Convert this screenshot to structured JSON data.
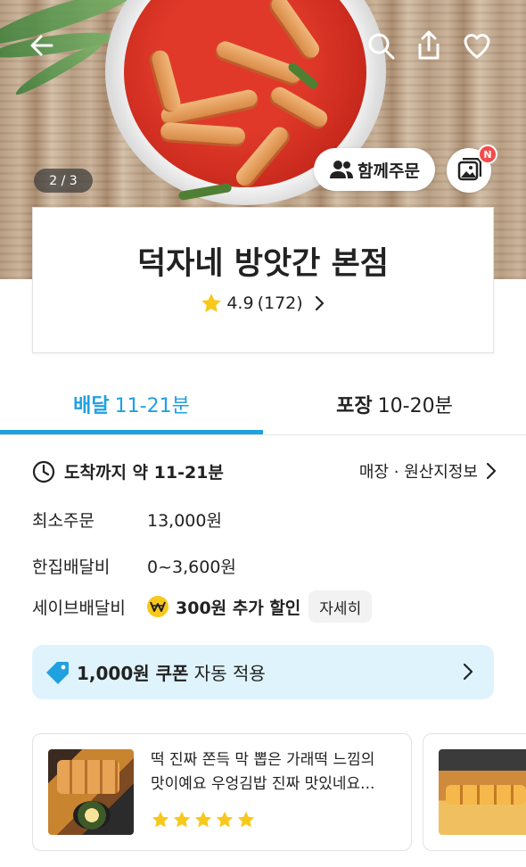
{
  "hero": {
    "page_indicator": "2 / 3",
    "group_order_label": "함께주문",
    "gallery_badge": "N"
  },
  "store": {
    "name": "덕자네 방앗간 본점",
    "rating": "4.9",
    "review_count": "(172)"
  },
  "tabs": [
    {
      "label": "배달",
      "time": "11-21분",
      "active": true
    },
    {
      "label": "포장",
      "time": "10-20분",
      "active": false
    }
  ],
  "info": {
    "arrival_text": "도착까지 약 11-21분",
    "store_info_link": "매장 · 원산지정보",
    "min_order_label": "최소주문",
    "min_order_value": "13,000원",
    "delivery_fee_label": "한집배달비",
    "delivery_fee_value": "0~3,600원",
    "save_fee_label": "세이브배달비",
    "save_fee_value": "300원 추가 할인",
    "detail_button": "자세히"
  },
  "coupon": {
    "amount": "1,000원 쿠폰",
    "suffix": "자동 적용"
  },
  "reviews": [
    {
      "line1": "떡 진짜 쫀득 막 뽑은 가래떡 느낌의",
      "line2": "맛이예요 우엉김밥 진짜 맛있네요...",
      "stars": 5
    }
  ],
  "colors": {
    "accent": "#1fa1e0",
    "coupon_bg": "#dff3fc",
    "star": "#f8c81a",
    "badge_red": "#f14b4b"
  },
  "icons": [
    "back-arrow-icon",
    "search-icon",
    "share-icon",
    "heart-icon",
    "group-people-icon",
    "gallery-icon",
    "star-icon",
    "chevron-right-icon",
    "clock-icon",
    "save-delivery-icon",
    "coupon-tag-icon"
  ]
}
